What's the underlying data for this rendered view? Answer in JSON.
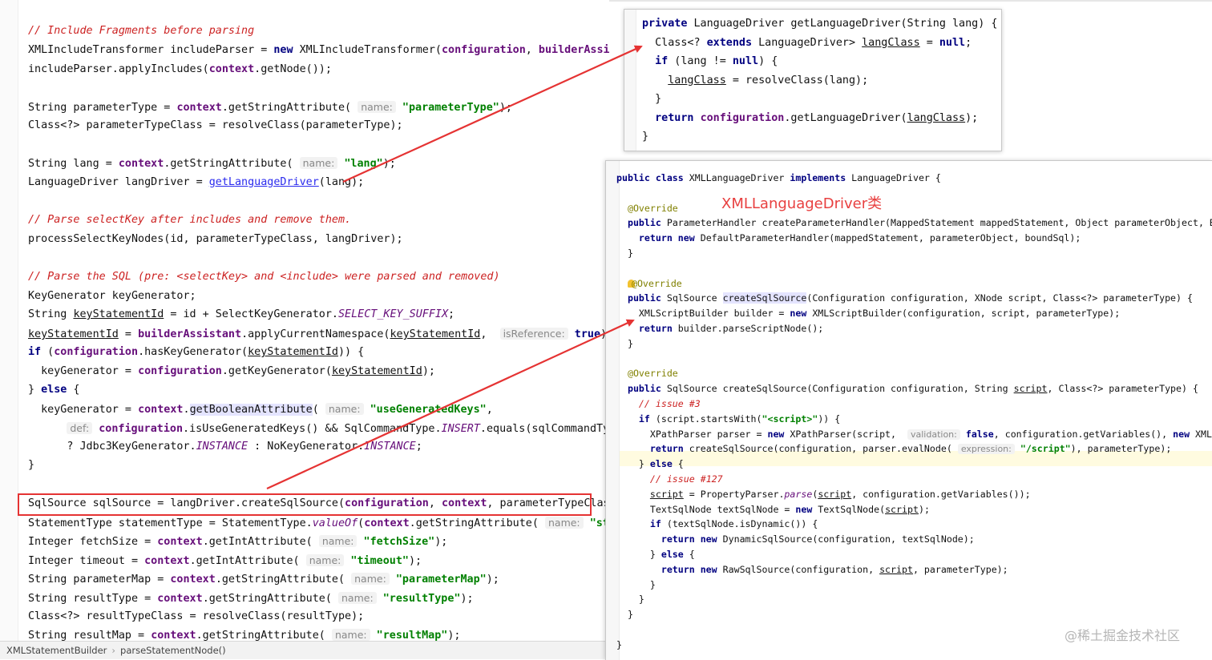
{
  "editor": {
    "lines": [
      {
        "t": 40,
        "cls": "cmr",
        "text": "// Include Fragments before parsing"
      },
      {
        "t": 64,
        "html": "XMLIncludeTransformer includeParser = <span class='kw'>new</span> XMLIncludeTransformer(<span class='fld'>configuration</span>, <span class='fld'>builderAssistant</span>);"
      },
      {
        "t": 88,
        "html": "includeParser.applyIncludes(<span class='fld'>context</span>.getNode());"
      },
      {
        "t": 135,
        "html": "String parameterType = <span class='fld'>context</span>.getStringAttribute( <span class='hint'>name:</span> <span class='str'>\"parameterType\"</span>);"
      },
      {
        "t": 158,
        "html": "Class&lt;?&gt; parameterTypeClass = resolveClass(parameterType);"
      },
      {
        "t": 205,
        "html": "String lang = <span class='fld'>context</span>.getStringAttribute( <span class='hint'>name:</span> <span class='str'>\"lang\"</span>);"
      },
      {
        "t": 229,
        "html": "LanguageDriver langDriver = <span class='link'>getLanguageDriver</span>(lang);"
      },
      {
        "t": 276,
        "cls": "cmr",
        "text": "// Parse selectKey after includes and remove them."
      },
      {
        "t": 300,
        "html": "processSelectKeyNodes(id, parameterTypeClass, langDriver);"
      },
      {
        "t": 347,
        "cls": "cmr",
        "text": "// Parse the SQL (pre: <selectKey> and <include> were parsed and removed)"
      },
      {
        "t": 371,
        "html": "KeyGenerator keyGenerator;"
      },
      {
        "t": 394,
        "html": "String <span class='ul'>keyStatementId</span> = id + SelectKeyGenerator.<span class='sfld'>SELECT_KEY_SUFFIX</span>;"
      },
      {
        "t": 418,
        "html": "<span class='ul'>keyStatementId</span> = <span class='fld'>builderAssistant</span>.applyCurrentNamespace(<span class='ul'>keyStatementId</span>,  <span class='hint'>isReference:</span> <span class='kw'>true</span>);"
      },
      {
        "t": 441,
        "html": "<span class='kw'>if</span> (<span class='fld'>configuration</span>.hasKeyGenerator(<span class='ul'>keyStatementId</span>)) {"
      },
      {
        "t": 465,
        "html": "  keyGenerator = <span class='fld'>configuration</span>.getKeyGenerator(<span class='ul'>keyStatementId</span>);"
      },
      {
        "t": 488,
        "html": "} <span class='kw'>else</span> {"
      },
      {
        "t": 512,
        "html": "  keyGenerator = <span class='fld'>context</span>.<span class='hl'>getBooleanAttribute</span>( <span class='hint'>name:</span> <span class='str'>\"useGeneratedKeys\"</span>,"
      },
      {
        "t": 536,
        "html": "      <span class='hint'>def:</span> <span class='fld'>configuration</span>.isUseGeneratedKeys() &amp;&amp; SqlCommandType.<span class='sfld'>INSERT</span>.equals(sqlCommandType))"
      },
      {
        "t": 559,
        "html": "      ? Jdbc3KeyGenerator.<span class='sfld'>INSTANCE</span> : NoKeyGenerator.<span class='sfld'>INSTANCE</span>;"
      },
      {
        "t": 582,
        "html": "}"
      },
      {
        "t": 630,
        "html": "SqlSource sqlSource = langDriver.createSqlSource(<span class='fld'>configuration</span>, <span class='fld'>context</span>, parameterTypeClass);"
      },
      {
        "t": 654,
        "html": "StatementType statementType = StatementType.<span class='sfld'>valueOf</span>(<span class='fld'>context</span>.getStringAttribute( <span class='hint'>name:</span> <span class='str'>\"statementType\"</span>"
      },
      {
        "t": 677,
        "html": "Integer fetchSize = <span class='fld'>context</span>.getIntAttribute( <span class='hint'>name:</span> <span class='str'>\"fetchSize\"</span>);"
      },
      {
        "t": 701,
        "html": "Integer timeout = <span class='fld'>context</span>.getIntAttribute( <span class='hint'>name:</span> <span class='str'>\"timeout\"</span>);"
      },
      {
        "t": 724,
        "html": "String parameterMap = <span class='fld'>context</span>.getStringAttribute( <span class='hint'>name:</span> <span class='str'>\"parameterMap\"</span>);"
      },
      {
        "t": 748,
        "html": "String resultType = <span class='fld'>context</span>.getStringAttribute( <span class='hint'>name:</span> <span class='str'>\"resultType\"</span>);"
      },
      {
        "t": 771,
        "html": "Class&lt;?&gt; resultTypeClass = resolveClass(resultType);"
      },
      {
        "t": 794,
        "html": "String resultMap = <span class='fld'>context</span>.getStringAttribute( <span class='hint'>name:</span> <span class='str'>\"resultMap\"</span>);"
      }
    ]
  },
  "statusbar": {
    "class_crumb": "XMLStatementBuilder",
    "method_crumb": "parseStatementNode()"
  },
  "popup_driver": {
    "lines": [
      {
        "html": "<span class='kw'>private</span> LanguageDriver getLanguageDriver(String lang) {"
      },
      {
        "html": "  Class&lt;? <span class='kw'>extends</span> LanguageDriver&gt; <span class='ul'>langClass</span> = <span class='kw'>null</span>;"
      },
      {
        "html": "  <span class='kw'>if</span> (lang != <span class='kw'>null</span>) {"
      },
      {
        "html": "    <span class='ul'>langClass</span> = resolveClass(lang);"
      },
      {
        "html": "  }"
      },
      {
        "html": "  <span class='kw'>return</span> <span class='fld'>configuration</span>.getLanguageDriver(<span class='ul'>langClass</span>);"
      },
      {
        "html": "}"
      }
    ]
  },
  "popup_xml": {
    "class_label": "XMLLanguageDriver类",
    "lines": [
      {
        "html": "<span class='kw'>public class</span> XMLLanguageDriver <span class='kw'>implements</span> LanguageDriver {"
      },
      {
        "html": ""
      },
      {
        "html": "  <span class='ann'>@Override</span>"
      },
      {
        "html": "  <span class='kw'>public</span> ParameterHandler createParameterHandler(MappedStatement mappedStatement, Object parameterObject, BoundSql boundSql) {"
      },
      {
        "html": "    <span class='kw'>return new</span> DefaultParameterHandler(mappedStatement, parameterObject, boundSql);"
      },
      {
        "html": "  }"
      },
      {
        "html": ""
      },
      {
        "html": "  <span class='bulb'></span><span class='ann'>@Override</span>"
      },
      {
        "html": "  <span class='kw'>public</span> SqlSource <span class='hl'>createSqlSource</span>(Configuration configuration, XNode script, Class&lt;?&gt; parameterType) {"
      },
      {
        "html": "    XMLScriptBuilder builder = <span class='kw'>new</span> XMLScriptBuilder(configuration, script, parameterType);"
      },
      {
        "html": "    <span class='kw'>return</span> builder.parseScriptNode();"
      },
      {
        "html": "  }"
      },
      {
        "html": ""
      },
      {
        "html": "  <span class='ann'>@Override</span>"
      },
      {
        "html": "  <span class='kw'>public</span> SqlSource createSqlSource(Configuration configuration, String <span class='ul'>script</span>, Class&lt;?&gt; parameterType) {"
      },
      {
        "html": "    <span class='cmr'>// issue #3</span>"
      },
      {
        "html": "    <span class='kw'>if</span> (script.startsWith(<span class='str'>\"&lt;script&gt;\"</span>)) {"
      },
      {
        "html": "      XPathParser parser = <span class='kw'>new</span> XPathParser(script,  <span class='hint'>validation:</span> <span class='kw'>false</span>, configuration.getVariables(), <span class='kw'>new</span> XMLMapperEntityResolver());"
      },
      {
        "html": "      <span class='kw'>return</span> createSqlSource(configuration, parser.evalNode( <span class='hint'>expression:</span> <span class='str'>\"/script\"</span>), parameterType);"
      },
      {
        "html": "    } <span class='kw'>else</span> {"
      },
      {
        "html": "      <span class='cmr'>// issue #127</span>"
      },
      {
        "html": "      <span class='ul'>script</span> = PropertyParser.<span class='sfld'>parse</span>(<span class='ul'>script</span>, configuration.getVariables());"
      },
      {
        "html": "      TextSqlNode textSqlNode = <span class='kw'>new</span> TextSqlNode(<span class='ul'>script</span>);"
      },
      {
        "html": "      <span class='kw'>if</span> (textSqlNode.isDynamic()) {"
      },
      {
        "html": "        <span class='kw'>return new</span> DynamicSqlSource(configuration, textSqlNode);"
      },
      {
        "html": "      } <span class='kw'>else</span> {"
      },
      {
        "html": "        <span class='kw'>return new</span> RawSqlSource(configuration, <span class='ul'>script</span>, parameterType);"
      },
      {
        "html": "      }"
      },
      {
        "html": "    }"
      },
      {
        "html": "  }"
      },
      {
        "html": ""
      },
      {
        "html": "}"
      }
    ]
  },
  "watermark": "@稀土掘金技术社区",
  "colors": {
    "annotation_red": "#e53333",
    "keyword": "#000080",
    "string": "#008000",
    "field": "#660e7a"
  }
}
